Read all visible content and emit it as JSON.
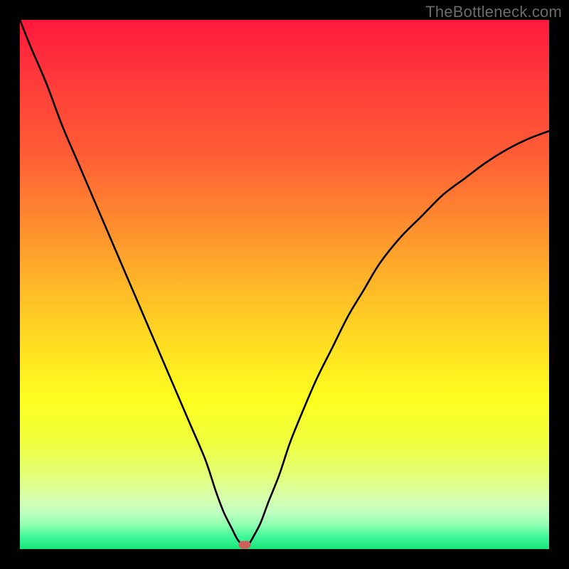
{
  "watermark": "TheBottleneck.com",
  "chart_data": {
    "type": "line",
    "title": "",
    "xlabel": "",
    "ylabel": "",
    "xlim": [
      0,
      100
    ],
    "ylim": [
      0,
      100
    ],
    "grid": false,
    "legend": false,
    "annotations": [],
    "series": [
      {
        "name": "bottleneck-curve",
        "color": "#000000",
        "x": [
          0,
          2,
          5,
          8,
          11,
          14,
          17,
          20,
          23,
          26,
          29,
          32,
          35,
          37,
          38.5,
          40,
          41,
          41.8,
          42.5,
          43.3,
          44.2,
          45.5,
          47,
          49,
          51,
          53,
          56,
          59,
          62,
          65,
          68,
          72,
          76,
          80,
          84,
          88,
          92,
          96,
          100
        ],
        "y": [
          100,
          95,
          88,
          80,
          73,
          66,
          59,
          52,
          45,
          38,
          31,
          24,
          17,
          11,
          7,
          4,
          2,
          1,
          0.5,
          1,
          2.5,
          5,
          9,
          14,
          20,
          25,
          32,
          38,
          44,
          49,
          54,
          59,
          63,
          67,
          70,
          73,
          75.5,
          77.5,
          79
        ]
      }
    ],
    "marker": {
      "x": 42.5,
      "y": 0.8,
      "color": "#cf5f5b"
    },
    "background_gradient": {
      "type": "vertical",
      "stops": [
        {
          "pos": 0.0,
          "color": "#ff183e"
        },
        {
          "pos": 0.12,
          "color": "#ff3c3a"
        },
        {
          "pos": 0.25,
          "color": "#ff5c35"
        },
        {
          "pos": 0.38,
          "color": "#ff8a2f"
        },
        {
          "pos": 0.5,
          "color": "#ffb728"
        },
        {
          "pos": 0.62,
          "color": "#ffe021"
        },
        {
          "pos": 0.72,
          "color": "#fdff1f"
        },
        {
          "pos": 0.8,
          "color": "#efff3f"
        },
        {
          "pos": 0.86,
          "color": "#e4ff77"
        },
        {
          "pos": 0.9,
          "color": "#d8ffaa"
        },
        {
          "pos": 0.93,
          "color": "#c1ffc1"
        },
        {
          "pos": 0.955,
          "color": "#8effb0"
        },
        {
          "pos": 0.975,
          "color": "#44f79a"
        },
        {
          "pos": 1.0,
          "color": "#14e879"
        }
      ]
    }
  }
}
